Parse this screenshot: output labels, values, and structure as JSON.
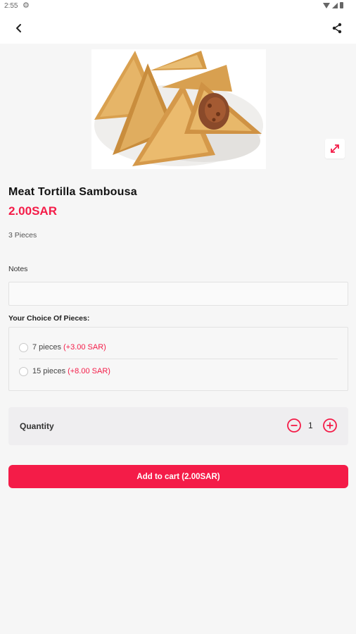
{
  "status_bar": {
    "time": "2:55"
  },
  "product": {
    "name": "Meat Tortilla Sambousa",
    "price": "2.00SAR",
    "description": "3 Pieces"
  },
  "notes": {
    "label": "Notes",
    "value": ""
  },
  "choices": {
    "label": "Your Choice Of Pieces:",
    "options": [
      {
        "label": "7 pieces",
        "extra": "(+3.00 SAR)"
      },
      {
        "label": "15 pieces",
        "extra": "(+8.00 SAR)"
      }
    ]
  },
  "quantity": {
    "label": "Quantity",
    "value": "1"
  },
  "cart_button": {
    "label": "Add to cart (2.00SAR)"
  },
  "colors": {
    "accent": "#f41c48",
    "background": "#f6f6f6"
  },
  "icons": {
    "back": "back-arrow-icon",
    "share": "share-icon",
    "expand": "expand-icon",
    "minus": "minus-circle-icon",
    "plus": "plus-circle-icon"
  }
}
